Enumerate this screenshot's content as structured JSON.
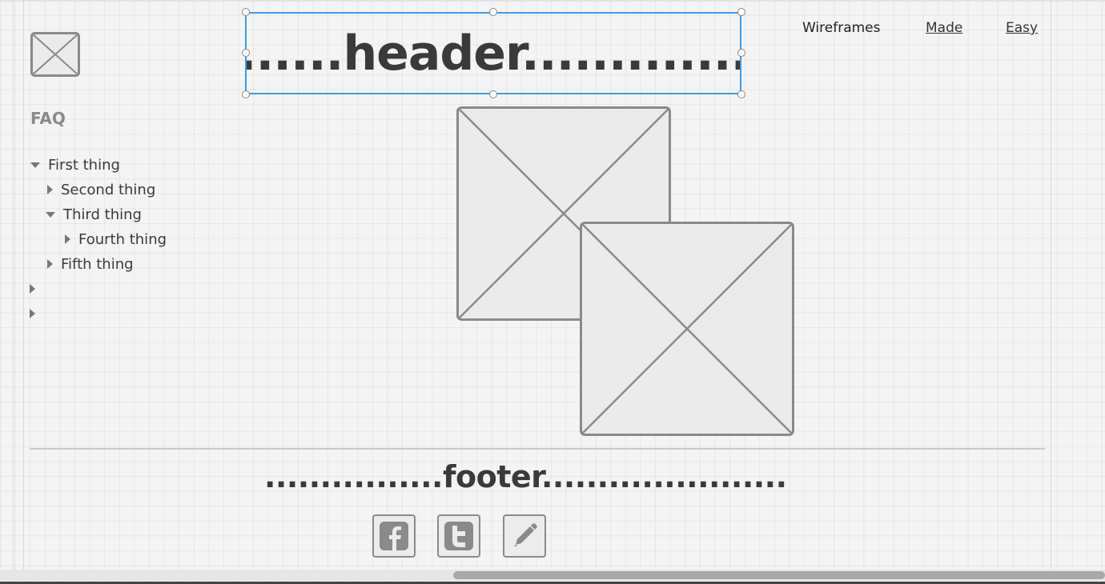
{
  "header": {
    "text": "........header..............."
  },
  "nav": {
    "items": [
      "Wireframes",
      "Made",
      "Easy"
    ]
  },
  "sidebar": {
    "title": "FAQ",
    "tree": [
      {
        "label": "First thing",
        "state": "expanded",
        "level": 0
      },
      {
        "label": "Second thing",
        "state": "collapsed",
        "level": 1
      },
      {
        "label": "Third thing",
        "state": "expanded",
        "level": 1
      },
      {
        "label": "Fourth thing",
        "state": "collapsed",
        "level": 2
      },
      {
        "label": "Fifth thing",
        "state": "collapsed",
        "level": 1
      },
      {
        "label": "",
        "state": "collapsed",
        "level": 0
      },
      {
        "label": "",
        "state": "collapsed",
        "level": 0
      }
    ]
  },
  "footer": {
    "text": "................footer......................",
    "social_icons": [
      "facebook-icon",
      "twitter-icon",
      "pencil-icon"
    ]
  },
  "colors": {
    "selection": "#3d9be6",
    "placeholder_stroke": "#8a8a8a",
    "placeholder_fill": "#ebebeb"
  }
}
